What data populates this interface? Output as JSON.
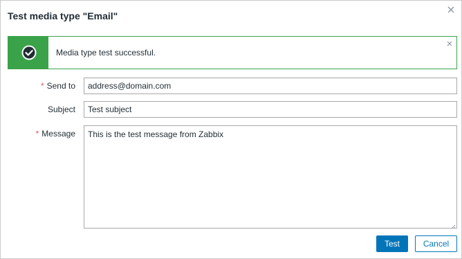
{
  "dialog": {
    "title": "Test media type \"Email\"",
    "close_icon": "close-icon"
  },
  "message": {
    "text": "Media type test successful.",
    "status_icon": "check-circle-icon",
    "close_icon": "close-icon",
    "accent_color": "#3aa34a"
  },
  "form": {
    "send_to": {
      "label": "Send to",
      "required": true,
      "value": "address@domain.com"
    },
    "subject": {
      "label": "Subject",
      "required": false,
      "value": "Test subject"
    },
    "message": {
      "label": "Message",
      "required": true,
      "value": "This is the test message from Zabbix"
    },
    "required_marker": "*"
  },
  "buttons": {
    "test_label": "Test",
    "cancel_label": "Cancel",
    "primary_color": "#0275b8"
  }
}
